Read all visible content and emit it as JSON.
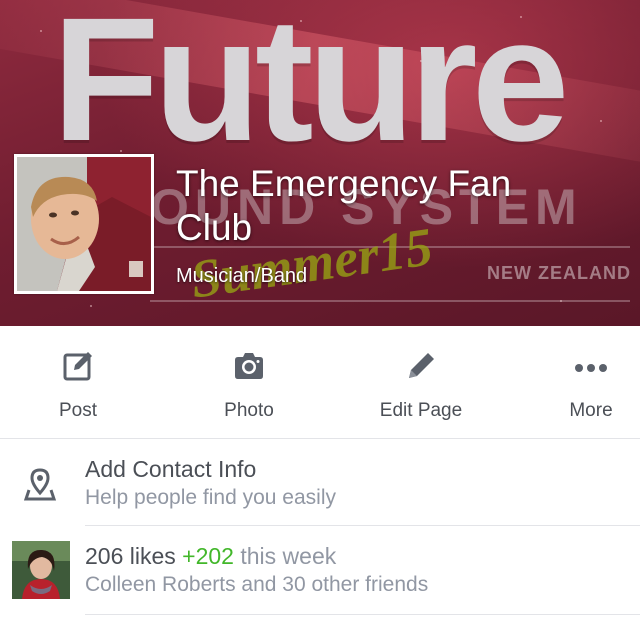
{
  "cover": {
    "headline": "Future",
    "subline": "OUND SYSTEM",
    "script_text": "Summer15",
    "region": "NEW ZEALAND"
  },
  "page": {
    "name": "The Emergency Fan Club",
    "category": "Musician/Band"
  },
  "actions": [
    {
      "label": "Post",
      "icon": "compose-icon"
    },
    {
      "label": "Photo",
      "icon": "camera-icon"
    },
    {
      "label": "Edit Page",
      "icon": "pencil-icon"
    },
    {
      "label": "More",
      "icon": "more-dots-icon"
    }
  ],
  "contact": {
    "title": "Add Contact Info",
    "subtitle": "Help people find you easily",
    "icon": "location-pin-icon"
  },
  "likes": {
    "count_text": "206 likes",
    "delta_text": "+202",
    "period_text": "this week",
    "friends_text": "Colleen Roberts and 30 other friends"
  },
  "colors": {
    "text": "#4b4f56",
    "muted": "#9197a3",
    "positive": "#42b72a",
    "divider": "#e3e4e8"
  }
}
